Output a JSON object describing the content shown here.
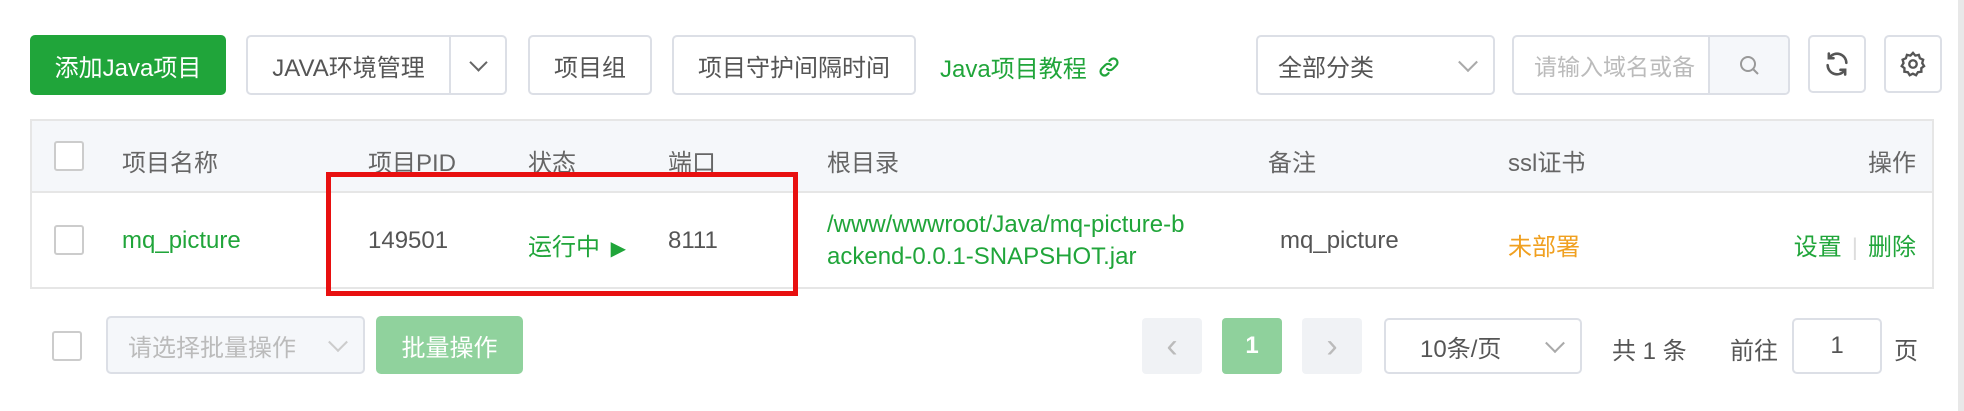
{
  "toolbar": {
    "add_label": "添加Java项目",
    "env_label": "JAVA环境管理",
    "group_label": "项目组",
    "guard_label": "项目守护间隔时间",
    "tutorial_label": "Java项目教程",
    "category_value": "全部分类",
    "search_placeholder": "请输入域名或备"
  },
  "table": {
    "headers": {
      "name": "项目名称",
      "pid": "项目PID",
      "status": "状态",
      "port": "端口",
      "root": "根目录",
      "remark": "备注",
      "ssl": "ssl证书",
      "actions": "操作"
    },
    "rows": [
      {
        "name": "mq_picture",
        "pid": "149501",
        "status": "运行中",
        "status_icon": "▶",
        "port": "8111",
        "root_line1": "/www/wwwroot/Java/mq-picture-b",
        "root_line2": "ackend-0.0.1-SNAPSHOT.jar",
        "remark": "mq_picture",
        "ssl": "未部署",
        "action_settings": "设置",
        "action_sep": "|",
        "action_delete": "删除"
      }
    ]
  },
  "footer": {
    "batch_select_placeholder": "请选择批量操作",
    "batch_button": "批量操作",
    "page_prev": "‹",
    "page_current": "1",
    "page_next": "›",
    "page_size": "10条/页",
    "total": "共 1 条",
    "goto_label": "前往",
    "goto_value": "1",
    "goto_unit": "页"
  },
  "colors": {
    "brand": "#20a53a",
    "warning": "#f0a020",
    "highlight": "#e81010"
  },
  "icons": [
    "chevron-down-icon",
    "link-icon",
    "search-icon",
    "refresh-icon",
    "gear-icon",
    "play-icon"
  ]
}
